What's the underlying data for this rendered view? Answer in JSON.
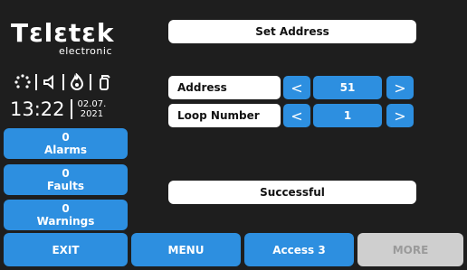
{
  "logo": {
    "brand": "Tεlεtεk",
    "sub": "electronic"
  },
  "status": {
    "time": "13:22",
    "date_line1": "02.07.",
    "date_line2": "2021"
  },
  "side": {
    "alarms": {
      "count": "0",
      "label": "Alarms"
    },
    "faults": {
      "count": "0",
      "label": "Faults"
    },
    "warnings": {
      "count": "0",
      "label": "Warnings"
    }
  },
  "main": {
    "title": "Set Address",
    "address_label": "Address",
    "address_value": "51",
    "loop_label": "Loop Number",
    "loop_value": "1",
    "result": "Successful",
    "prev_arrow": "<",
    "next_arrow": ">"
  },
  "bottom": {
    "exit": "EXIT",
    "menu": "MENU",
    "access": "Access 3",
    "more": "MORE"
  },
  "colors": {
    "accent": "#2d8fe0",
    "background": "#1e1e1e",
    "panel": "#ffffff",
    "disabled": "#cfcfcf"
  }
}
